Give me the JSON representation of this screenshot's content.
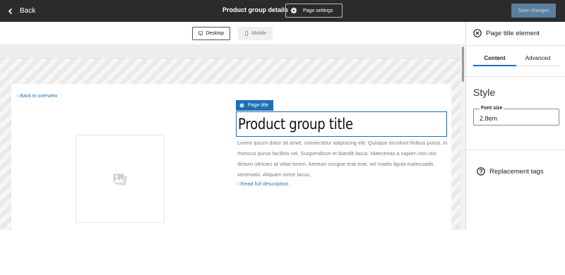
{
  "topbar": {
    "back_label": "Back",
    "page_heading": "Product group details",
    "settings_label": "Page settings",
    "save_label": "Save changes"
  },
  "device_toggle": {
    "desktop_label": "Desktop",
    "mobile_label": "Mobile",
    "selected": "Desktop"
  },
  "preview": {
    "back_link": "‹ Back to overview",
    "element_tag": "Page title",
    "product_title": "Product group title",
    "description": "Lorem ipsum dolor sit amet, consectetur adipiscing elit. Quisque tincidunt finibus purus, in rhoncus purus facilisis vel. Suspendisse et blandit lacus. Maecenas a sapien non nisi dictum ultricies at vitae lorem. Aenean congue erat erat, vel mattis ligula malesuada venenatis. Aliquam tortor lacus,",
    "read_more": "› Read full description",
    "image_icon": "image-placeholder-icon"
  },
  "panel": {
    "title": "Page title element",
    "tabs": [
      {
        "label": "Content",
        "active": true
      },
      {
        "label": "Advanced",
        "active": false
      }
    ],
    "style_heading": "Style",
    "font_size_label": "Font size",
    "font_size_value": "2.8em",
    "replacement_label": "Replacement tags"
  },
  "colors": {
    "topbar_bg": "#2b2b2b",
    "accent": "#1f6fb5",
    "link": "#2a73b8",
    "save_disabled": "#5b7fa0"
  }
}
